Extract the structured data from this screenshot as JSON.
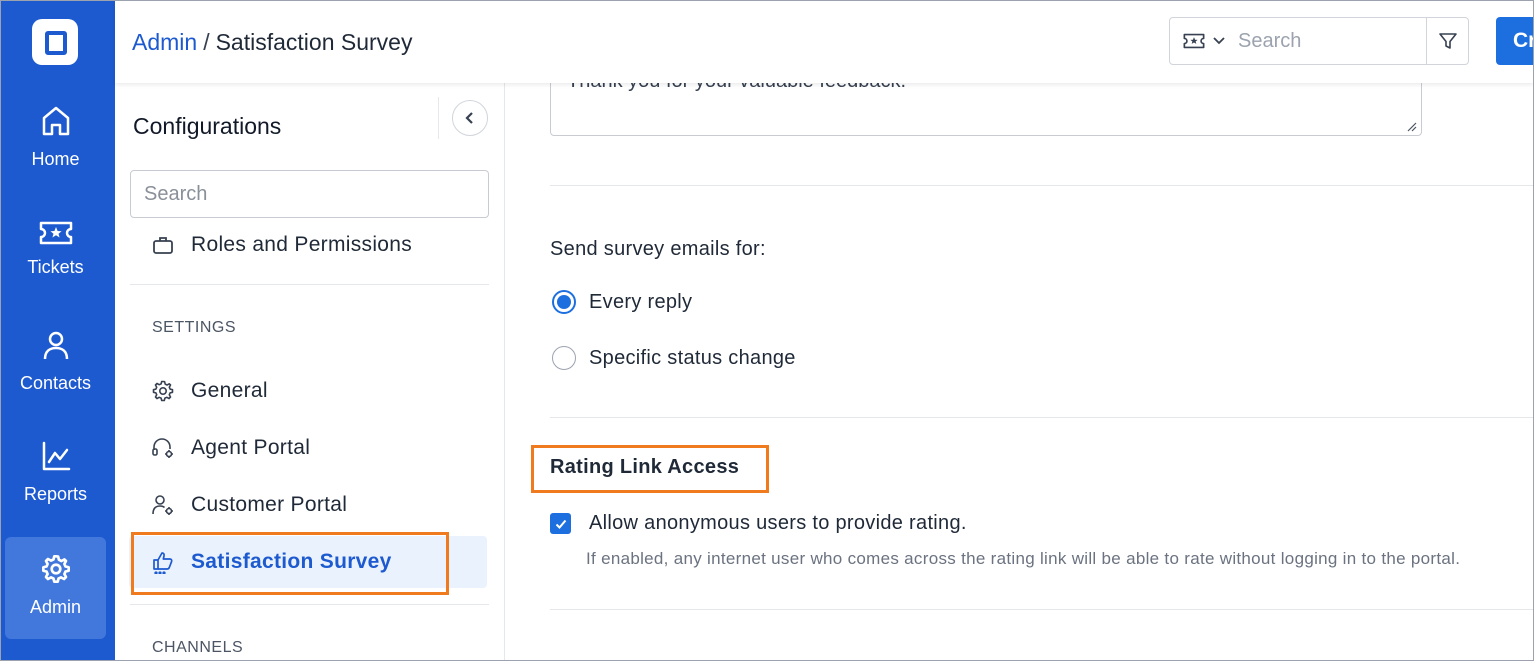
{
  "nav": {
    "items": [
      {
        "label": "Home",
        "icon": "home-icon"
      },
      {
        "label": "Tickets",
        "icon": "ticket-icon"
      },
      {
        "label": "Contacts",
        "icon": "user-icon"
      },
      {
        "label": "Reports",
        "icon": "chart-line-icon"
      },
      {
        "label": "Admin",
        "icon": "gear-icon",
        "active": true
      }
    ]
  },
  "header": {
    "breadcrumb_link": "Admin",
    "breadcrumb_sep": "/",
    "page_title": "Satisfaction Survey",
    "search_placeholder": "Search",
    "create_label": "Create"
  },
  "config": {
    "title": "Configurations",
    "search_placeholder": "Search",
    "top_item": "Roles and Permissions",
    "settings_header": "SETTINGS",
    "settings_items": [
      {
        "label": "General",
        "icon": "gear-icon"
      },
      {
        "label": "Agent Portal",
        "icon": "headset-gear-icon"
      },
      {
        "label": "Customer Portal",
        "icon": "user-gear-icon"
      },
      {
        "label": "Satisfaction Survey",
        "icon": "thumbs-up-icon",
        "active": true
      }
    ],
    "channels_header": "CHANNELS"
  },
  "main": {
    "thankyou_text": "Thank you for your valuable feedback.",
    "send_label": "Send survey emails for:",
    "send_options": [
      {
        "label": "Every reply",
        "selected": true
      },
      {
        "label": "Specific status change",
        "selected": false
      }
    ],
    "rating_title": "Rating Link Access",
    "anon_label": "Allow anonymous users to provide rating.",
    "anon_checked": true,
    "anon_help": "If enabled, any internet user who comes across the rating link will be able to rate without logging in to the portal."
  },
  "colors": {
    "primary": "#1d5ad0",
    "accent": "#1d6fe0",
    "highlight": "#f07a1e"
  }
}
